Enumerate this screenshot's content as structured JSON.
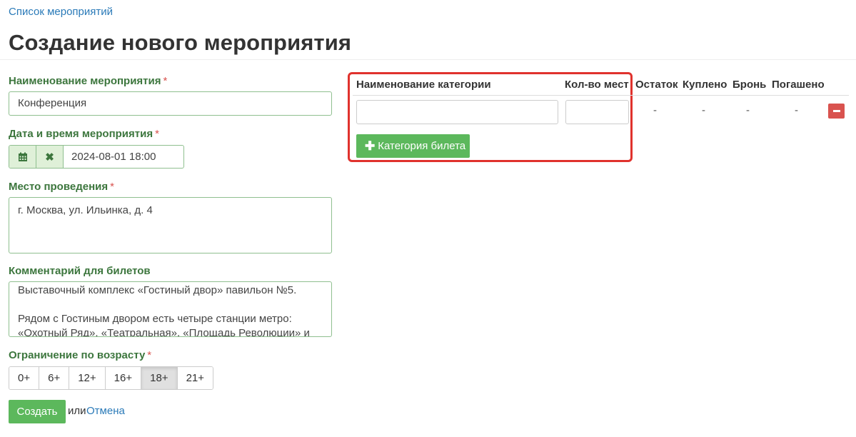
{
  "breadcrumb": {
    "link": "Список мероприятий"
  },
  "page": {
    "title": "Создание нового мероприятия"
  },
  "form": {
    "name": {
      "label": "Наименование мероприятия",
      "required": "*",
      "value": "Конференция"
    },
    "datetime": {
      "label": "Дата и время мероприятия",
      "required": "*",
      "value": "2024-08-01 18:00",
      "calendar_icon": "calendar-icon",
      "clear_icon": "close-icon",
      "clear_glyph": "✖"
    },
    "venue": {
      "label": "Место проведения",
      "required": "*",
      "value": "г. Москва, ул. Ильинка, д. 4"
    },
    "comment": {
      "label": "Комментарий для билетов",
      "value": "Выставочный комплекс «Гостиный двор» павильон №5.\n\nРядом с Гостиным двором есть четыре станции метро: «Охотный Ряд», «Театральная», «Площадь Революции» и «Китай-город»."
    },
    "age": {
      "label": "Ограничение по возрасту",
      "required": "*",
      "options": [
        "0+",
        "6+",
        "12+",
        "16+",
        "18+",
        "21+"
      ],
      "selected": "18+"
    },
    "submit_label": "Создать",
    "or_text": "или",
    "cancel_label": "Отмена"
  },
  "categories": {
    "headers": {
      "name": "Наименование категории",
      "seats": "Кол-во мест",
      "remaining": "Остаток",
      "bought": "Куплено",
      "booked": "Бронь",
      "redeemed": "Погашено"
    },
    "row": {
      "remaining": "-",
      "bought": "-",
      "booked": "-",
      "redeemed": "-"
    },
    "add_label": "Категория билета",
    "add_glyph": "✚",
    "highlight_color": "#e0322d"
  },
  "colors": {
    "label_green": "#3c763d",
    "button_green": "#5cb85c",
    "link_blue": "#2a7ab8",
    "danger_red": "#d9534f"
  }
}
